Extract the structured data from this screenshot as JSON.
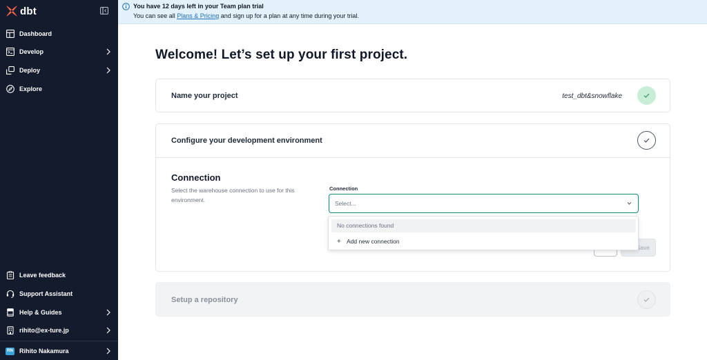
{
  "app": {
    "brand": "dbt"
  },
  "sidebar": {
    "nav": [
      {
        "label": "Dashboard",
        "icon": "dashboard-icon",
        "chevron": false
      },
      {
        "label": "Develop",
        "icon": "terminal-icon",
        "chevron": true
      },
      {
        "label": "Deploy",
        "icon": "deploy-icon",
        "chevron": true
      },
      {
        "label": "Explore",
        "icon": "compass-icon",
        "chevron": false
      }
    ],
    "bottom": [
      {
        "label": "Leave feedback",
        "icon": "clipboard-icon",
        "chevron": false
      },
      {
        "label": "Support Assistant",
        "icon": "headset-icon",
        "chevron": false
      },
      {
        "label": "Help & Guides",
        "icon": "book-icon",
        "chevron": true
      },
      {
        "label": "rihito@ex-ture.jp",
        "icon": "building-icon",
        "chevron": true
      }
    ],
    "user": {
      "initials": "RN",
      "name": "Rihito Nakamura"
    }
  },
  "banner": {
    "title": "You have 12 days left in your Team plan trial",
    "text_before": "You can see all ",
    "link": "Plans & Pricing",
    "text_after": " and sign up for a plan at any time during your trial."
  },
  "main": {
    "title": "Welcome! Let’s set up your first project.",
    "step_name": {
      "title": "Name your project",
      "value": "test_dbt&snowflake",
      "status": "complete"
    },
    "step_env": {
      "title": "Configure your development environment",
      "status": "in-progress",
      "connection": {
        "heading": "Connection",
        "description": "Select the warehouse connection to use for this environment.",
        "field_label": "Connection",
        "placeholder": "Select...",
        "dropdown": {
          "empty_text": "No connections found",
          "add_label": "Add new connection"
        },
        "save_label": "Save"
      }
    },
    "step_repo": {
      "title": "Setup a repository",
      "status": "pending"
    }
  },
  "colors": {
    "sidebar_bg": "#141b2d",
    "banner_bg": "#e3f1fb",
    "accent_teal": "#0e8c84",
    "success_bg": "#c9eed7",
    "brand_orange": "#ff694a",
    "link": "#1d6fb8"
  }
}
